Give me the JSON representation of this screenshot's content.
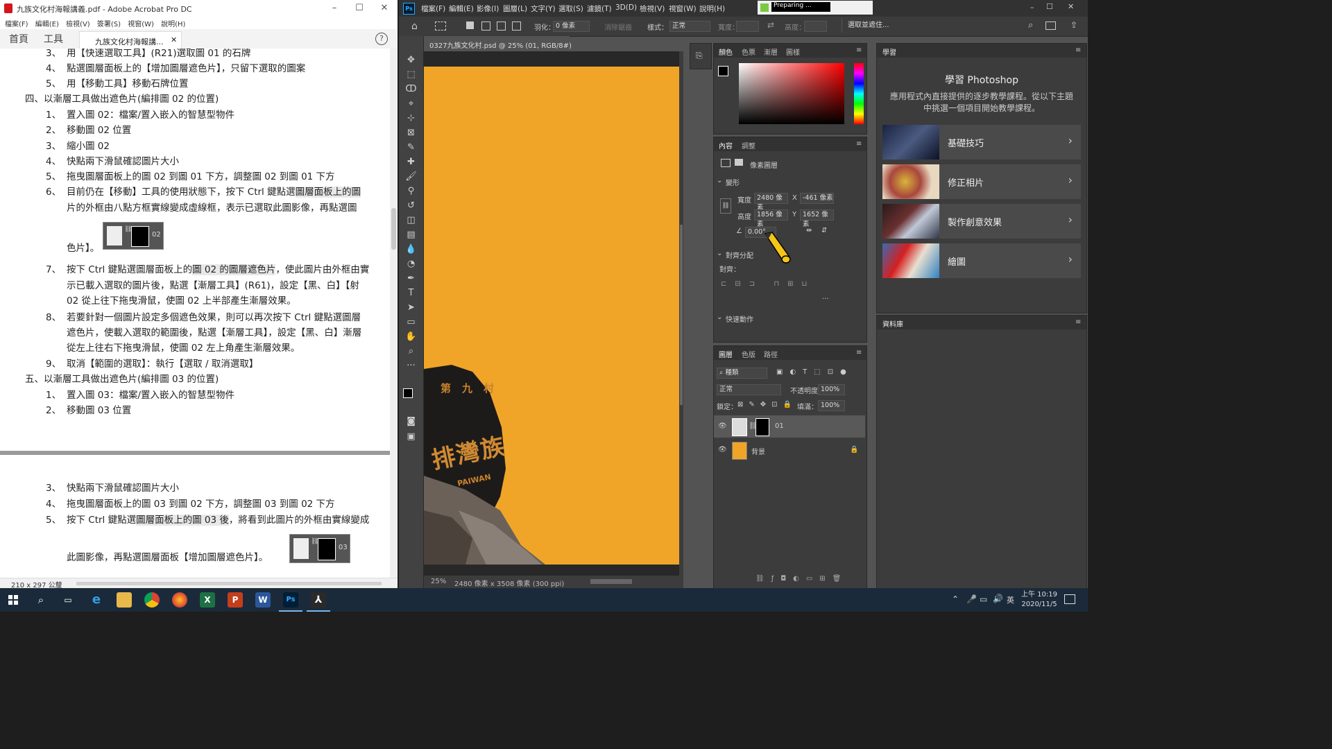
{
  "acrobat": {
    "window_title": "九族文化村海報講義.pdf - Adobe Acrobat Pro DC",
    "menu": [
      "檔案(F)",
      "編輯(E)",
      "檢視(V)",
      "簽署(S)",
      "視窗(W)",
      "說明(H)"
    ],
    "tab_home": "首頁",
    "tab_tools": "工具",
    "doc_tab": "九族文化村海報講...",
    "page_size": "210 x 297 公釐",
    "lines": [
      {
        "num": "3、",
        "text": "用【快速選取工具】(R21)選取圖 01 的石牌"
      },
      {
        "num": "4、",
        "text": "點選圖層面板上的【增加圖層遮色片】，只留下選取的圖案"
      },
      {
        "num": "5、",
        "text": "用【移動工具】移動石牌位置"
      },
      {
        "num": "",
        "text": "四、以漸層工具做出遮色片(編排圖 02 的位置)"
      },
      {
        "num": "1、",
        "text": "置入圖 02：檔案/置入嵌入的智慧型物件"
      },
      {
        "num": "2、",
        "text": "移動圖 02 位置"
      },
      {
        "num": "3、",
        "text": "縮小圖 02"
      },
      {
        "num": "4、",
        "text": "快點兩下滑鼠確認圖片大小"
      },
      {
        "num": "5、",
        "text": "拖曳圖層面板上的圖 02 到圖 01 下方，調整圖 02 到圖 01 下方"
      },
      {
        "num": "6、",
        "text": "目前仍在【移動】工具的使用狀態下，按下 Ctrl 鍵點選圖層面板上的圖"
      },
      {
        "num": "",
        "text": "片的外框由八點方框實線變成虛線框，表示已選取此圖影像，再點選圖"
      },
      {
        "num": "",
        "text": "色片】。"
      },
      {
        "num": "7、",
        "text": "按下 Ctrl 鍵點選圖層面板上的圖 02 的圖層遮色片，使此圖片由外框由實"
      },
      {
        "num": "",
        "text": "示已載入選取的圖片後，點選【漸層工具】(R61)，設定【黑、白】【射"
      },
      {
        "num": "",
        "text": "02 從上往下拖曳滑鼠，使圖 02 上半部產生漸層效果。"
      },
      {
        "num": "8、",
        "text": "若要針對一個圖片設定多個遮色效果，則可以再次按下 Ctrl 鍵點選圖層"
      },
      {
        "num": "",
        "text": "遮色片，使載入選取的範圍後，點選【漸層工具】，設定【黑、白】漸層"
      },
      {
        "num": "",
        "text": "從左上往右下拖曳滑鼠，使圖 02 左上角產生漸層效果。"
      },
      {
        "num": "9、",
        "text": "取消【範圍的選取】：執行【選取 / 取消選取】"
      },
      {
        "num": "",
        "text": "五、以漸層工具做出遮色片(編排圖 03 的位置)"
      },
      {
        "num": "1、",
        "text": "置入圖 03：檔案/置入嵌入的智慧型物件"
      },
      {
        "num": "2、",
        "text": "移動圖 03 位置"
      }
    ],
    "lines2": [
      {
        "num": "3、",
        "text": "快點兩下滑鼠確認圖片大小"
      },
      {
        "num": "4、",
        "text": "拖曳圖層面板上的圖 03 到圖 02 下方，調整圖 03 到圖 02 下方"
      },
      {
        "num": "5、",
        "text": "按下 Ctrl 鍵點選圖層面板上的圖 03 後，將看到此圖片的外框由實線變成"
      },
      {
        "num": "",
        "text": "此圖影像，再點選圖層面板【增加圖層遮色片】。"
      }
    ],
    "thumb1_label": "02",
    "thumb2_label": "03"
  },
  "photoshop": {
    "menu": [
      "檔案(F)",
      "編輯(E)",
      "影像(I)",
      "圖層(L)",
      "文字(Y)",
      "選取(S)",
      "濾鏡(T)",
      "3D(D)",
      "檢視(V)",
      "視窗(W)",
      "說明(H)"
    ],
    "preparing": "Preparing ...",
    "options": {
      "feather_label": "羽化：",
      "feather_value": "0 像素",
      "antialias": "消除鋸齒",
      "style_label": "樣式：",
      "style_value": "正常",
      "width_label": "寬度：",
      "height_label": "高度：",
      "select_mask": "選取並遮住..."
    },
    "doc_tab": "0327九族文化村.psd @ 25% (01, RGB/8#)",
    "status_zoom": "25%",
    "status_info": "2480 像素 x 3508 像素 (300 ppi)",
    "color_panel_tabs": [
      "顏色",
      "色票",
      "漸層",
      "圖樣"
    ],
    "props_tabs": [
      "內容",
      "調整"
    ],
    "props": {
      "pixel_layer": "像素圖層",
      "transform": "變形",
      "w_label": "寬度",
      "w_value": "2480 像素",
      "x_label": "X",
      "x_value": "-461 像素",
      "h_label": "高度",
      "h_value": "1856 像素",
      "y_label": "Y",
      "y_value": "1652 像素",
      "angle": "0.00°",
      "align": "對齊分配",
      "align_sub": "對齊：",
      "quick": "快速動作"
    },
    "layers_tabs": [
      "圖層",
      "色版",
      "路徑"
    ],
    "layers": {
      "kind": "種類",
      "blend": "正常",
      "opacity_label": "不透明度：",
      "opacity_value": "100%",
      "lock_label": "鎖定：",
      "fill_label": "填滿：",
      "fill_value": "100%",
      "items": [
        {
          "name": "01"
        },
        {
          "name": "背景"
        }
      ]
    },
    "learn": {
      "tab": "學習",
      "title": "學習 Photoshop",
      "desc": "應用程式內直接提供的逐步教學課程。從以下主題中挑選一個項目開始教學課程。",
      "cards": [
        "基礎技巧",
        "修正相片",
        "製作創意效果",
        "繪圖"
      ]
    },
    "library_tab": "資料庫",
    "canvas_sign_text": "排灣族",
    "canvas_sign_small": "第九村",
    "canvas_sign_latin": "PAIWAN"
  },
  "taskbar": {
    "ime": "英",
    "time": "上午 10:19",
    "date": "2020/11/5"
  },
  "colors": {
    "canvas_orange": "#f0a528",
    "ps_dark": "#323232",
    "acrobat_red": "#d4151b"
  }
}
